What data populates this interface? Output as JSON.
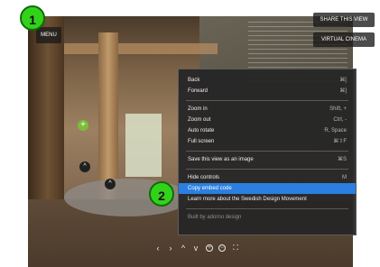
{
  "viewer": {
    "menu_label": "MENU",
    "share_label": "SHARE THIS VIEW",
    "cinema_label": "VIRTUAL CINEMA",
    "hotspot_plus": "+",
    "hotspot_up": "^"
  },
  "context_menu": {
    "items": [
      {
        "label": "Back",
        "shortcut": "⌘["
      },
      {
        "label": "Forward",
        "shortcut": "⌘]"
      },
      {
        "label": "Zoom in",
        "shortcut": "Shift, +"
      },
      {
        "label": "Zoom out",
        "shortcut": "Ctrl, -"
      },
      {
        "label": "Auto rotate",
        "shortcut": "R, Space"
      },
      {
        "label": "Full screen",
        "shortcut": "⌘⇧F"
      },
      {
        "label": "Save this view as an image",
        "shortcut": "⌘S"
      },
      {
        "label": "Hide controls",
        "shortcut": "M"
      },
      {
        "label": "Copy embed code",
        "shortcut": ""
      },
      {
        "label": "Learn more about the Swedish Design Movement",
        "shortcut": ""
      },
      {
        "label": "Built by adorno design",
        "shortcut": ""
      }
    ]
  },
  "toolbar": {
    "left": "‹",
    "right": "›",
    "up": "^",
    "down": "v",
    "zoom_in": "+",
    "zoom_out": "−",
    "fullscreen": "⛶"
  },
  "annotations": {
    "badge_1": "1",
    "badge_2": "2"
  },
  "colors": {
    "highlight": "#2b7fe0",
    "hotspot": "#7bbd3a",
    "badge": "#33d21a"
  }
}
